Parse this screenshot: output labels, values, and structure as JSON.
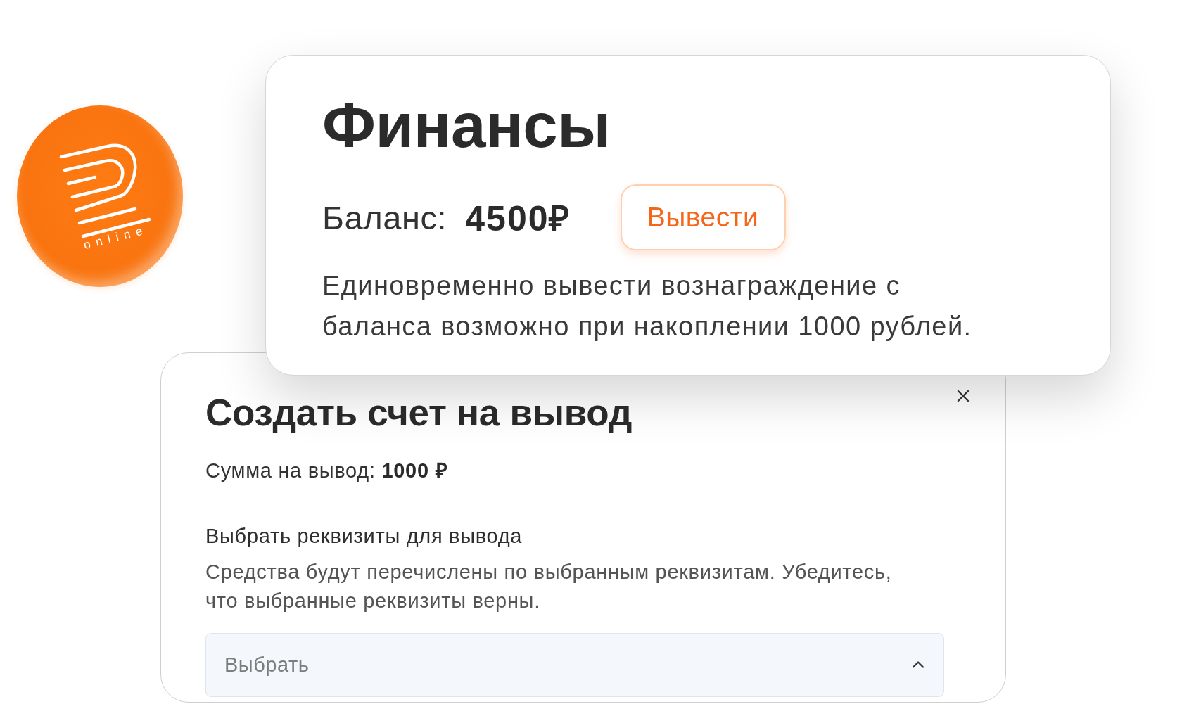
{
  "logo": {
    "text": "online"
  },
  "finance_card": {
    "title": "Финансы",
    "balance_label": "Баланс:",
    "balance_value": "4500₽",
    "withdraw_button": "Вывести",
    "note": "Единовременно вывести вознаграждение с баланса возможно при накоплении 1000 рублей."
  },
  "withdraw_dialog": {
    "title": "Создать счет на вывод",
    "amount": "Сумма на вывод: **1000 ₽**",
    "requisites_label": "Выбрать реквизиты для вывода",
    "requisites_hint": "Средства будут перечислены по выбранным реквизитам. Убедитесь, что выбранные реквизиты верны.",
    "select": {
      "placeholder": "Выбрать",
      "expanded": true
    }
  }
}
